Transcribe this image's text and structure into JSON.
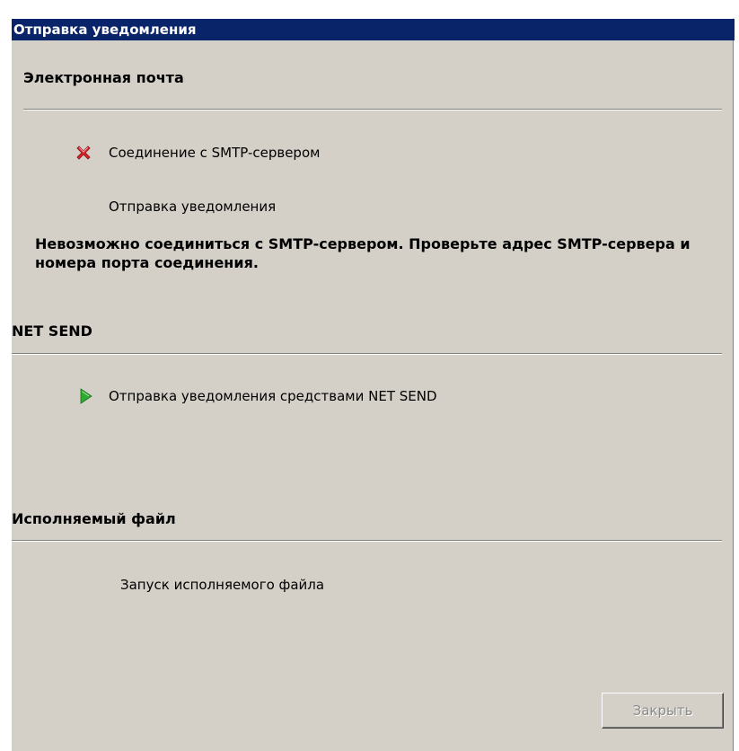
{
  "window": {
    "title": "Отправка уведомления"
  },
  "sections": [
    {
      "header": "Электронная почта",
      "items": [
        {
          "icon": "error-x-icon",
          "label": "Соединение с SMTP-сервером"
        },
        {
          "icon": "none",
          "label": "Отправка уведомления"
        }
      ],
      "error_message": "Невозможно соединиться с SMTP-сервером. Проверьте адрес SMTP-сервера и номера порта соединения."
    },
    {
      "header": "NET SEND",
      "items": [
        {
          "icon": "play-arrow-icon",
          "label": "Отправка уведомления средствами NET SEND"
        }
      ]
    },
    {
      "header": "Исполняемый файл",
      "items": [
        {
          "icon": "none",
          "label": "Запуск исполняемого файла"
        }
      ]
    }
  ],
  "buttons": {
    "close_label": "Закрыть",
    "close_enabled": false
  },
  "colors": {
    "titlebar": "#0a246a",
    "dialog_bg": "#d4d0c8",
    "error_icon": "#d8232a",
    "play_icon": "#2faa2f",
    "disabled_text": "#8a8a8a"
  }
}
